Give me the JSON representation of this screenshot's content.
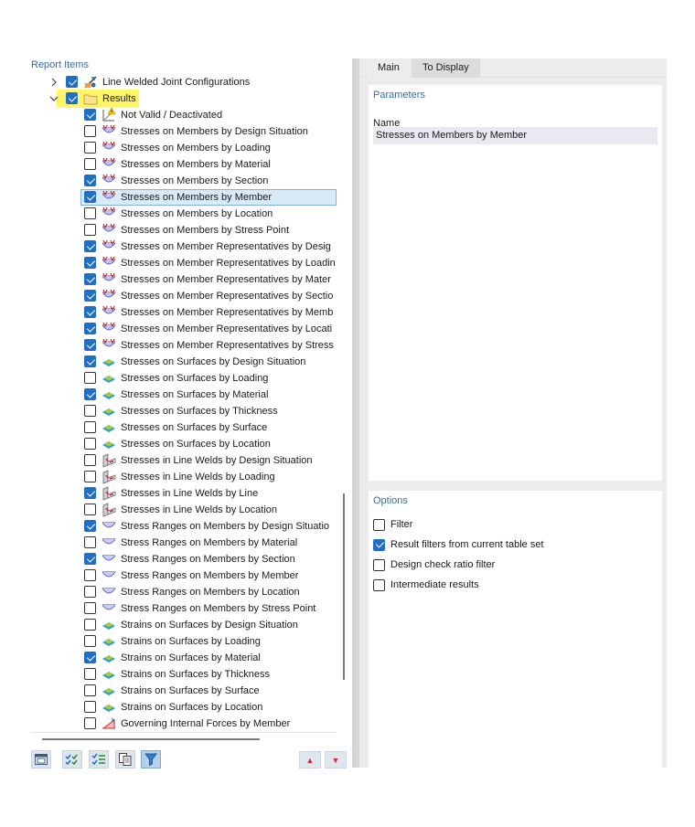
{
  "left_panel": {
    "title": "Report Items"
  },
  "tree": [
    {
      "label": "Line Welded Joint Configurations",
      "checked": true,
      "level": 0,
      "expander": "collapsed",
      "icon": "weld-config-icon"
    },
    {
      "label": "Results",
      "checked": true,
      "level": 0,
      "expander": "expanded",
      "icon": "folder-icon",
      "highlighted": true
    },
    {
      "label": "Not Valid / Deactivated",
      "checked": true,
      "level": 1,
      "icon": "warning-member-icon"
    },
    {
      "label": "Stresses on Members by Design Situation",
      "checked": false,
      "level": 1,
      "icon": "member-stress-icon"
    },
    {
      "label": "Stresses on Members by Loading",
      "checked": false,
      "level": 1,
      "icon": "member-stress-icon"
    },
    {
      "label": "Stresses on Members by Material",
      "checked": false,
      "level": 1,
      "icon": "member-stress-icon"
    },
    {
      "label": "Stresses on Members by Section",
      "checked": true,
      "level": 1,
      "icon": "member-stress-icon"
    },
    {
      "label": "Stresses on Members by Member",
      "checked": true,
      "level": 1,
      "icon": "member-stress-icon",
      "selected": true
    },
    {
      "label": "Stresses on Members by Location",
      "checked": false,
      "level": 1,
      "icon": "member-stress-icon"
    },
    {
      "label": "Stresses on Members by Stress Point",
      "checked": false,
      "level": 1,
      "icon": "member-stress-icon"
    },
    {
      "label": "Stresses on Member Representatives by Desig",
      "checked": true,
      "level": 1,
      "icon": "member-stress-icon"
    },
    {
      "label": "Stresses on Member Representatives by Loadin",
      "checked": true,
      "level": 1,
      "icon": "member-stress-icon"
    },
    {
      "label": "Stresses on Member Representatives by Mater",
      "checked": true,
      "level": 1,
      "icon": "member-stress-icon"
    },
    {
      "label": "Stresses on Member Representatives by Sectio",
      "checked": true,
      "level": 1,
      "icon": "member-stress-icon"
    },
    {
      "label": "Stresses on Member Representatives by Memb",
      "checked": true,
      "level": 1,
      "icon": "member-stress-icon"
    },
    {
      "label": "Stresses on Member Representatives by Locati",
      "checked": true,
      "level": 1,
      "icon": "member-stress-icon"
    },
    {
      "label": "Stresses on Member Representatives by Stress",
      "checked": true,
      "level": 1,
      "icon": "member-stress-icon"
    },
    {
      "label": "Stresses on Surfaces by Design Situation",
      "checked": true,
      "level": 1,
      "icon": "surface-stress-icon"
    },
    {
      "label": "Stresses on Surfaces by Loading",
      "checked": false,
      "level": 1,
      "icon": "surface-stress-icon"
    },
    {
      "label": "Stresses on Surfaces by Material",
      "checked": true,
      "level": 1,
      "icon": "surface-stress-icon"
    },
    {
      "label": "Stresses on Surfaces by Thickness",
      "checked": false,
      "level": 1,
      "icon": "surface-stress-icon"
    },
    {
      "label": "Stresses on Surfaces by Surface",
      "checked": false,
      "level": 1,
      "icon": "surface-stress-icon"
    },
    {
      "label": "Stresses on Surfaces by Location",
      "checked": false,
      "level": 1,
      "icon": "surface-stress-icon"
    },
    {
      "label": "Stresses in Line Welds by Design Situation",
      "checked": false,
      "level": 1,
      "icon": "weld-stress-icon"
    },
    {
      "label": "Stresses in Line Welds by Loading",
      "checked": false,
      "level": 1,
      "icon": "weld-stress-icon"
    },
    {
      "label": "Stresses in Line Welds by Line",
      "checked": true,
      "level": 1,
      "icon": "weld-stress-icon"
    },
    {
      "label": "Stresses in Line Welds by Location",
      "checked": false,
      "level": 1,
      "icon": "weld-stress-icon"
    },
    {
      "label": "Stress Ranges on Members by Design Situatio",
      "checked": true,
      "level": 1,
      "icon": "stress-range-icon"
    },
    {
      "label": "Stress Ranges on Members by Material",
      "checked": false,
      "level": 1,
      "icon": "stress-range-icon"
    },
    {
      "label": "Stress Ranges on Members by Section",
      "checked": true,
      "level": 1,
      "icon": "stress-range-icon"
    },
    {
      "label": "Stress Ranges on Members by Member",
      "checked": false,
      "level": 1,
      "icon": "stress-range-icon"
    },
    {
      "label": "Stress Ranges on Members by Location",
      "checked": false,
      "level": 1,
      "icon": "stress-range-icon"
    },
    {
      "label": "Stress Ranges on Members by Stress Point",
      "checked": false,
      "level": 1,
      "icon": "stress-range-icon"
    },
    {
      "label": "Strains on Surfaces by Design Situation",
      "checked": false,
      "level": 1,
      "icon": "surface-stress-icon"
    },
    {
      "label": "Strains on Surfaces by Loading",
      "checked": false,
      "level": 1,
      "icon": "surface-stress-icon"
    },
    {
      "label": "Strains on Surfaces by Material",
      "checked": true,
      "level": 1,
      "icon": "surface-stress-icon"
    },
    {
      "label": "Strains on Surfaces by Thickness",
      "checked": false,
      "level": 1,
      "icon": "surface-stress-icon"
    },
    {
      "label": "Strains on Surfaces by Surface",
      "checked": false,
      "level": 1,
      "icon": "surface-stress-icon"
    },
    {
      "label": "Strains on Surfaces by Location",
      "checked": false,
      "level": 1,
      "icon": "surface-stress-icon"
    },
    {
      "label": "Governing Internal Forces by Member",
      "checked": false,
      "level": 1,
      "icon": "internal-forces-icon"
    }
  ],
  "toolbar": {
    "buttons": [
      "window-icon",
      "check-all-icon",
      "toggle-check-icon",
      "report-copy-icon",
      "filter-icon"
    ],
    "move_up_glyph": "▲",
    "move_down_glyph": "▼"
  },
  "tabs": {
    "main": "Main",
    "to_display": "To Display"
  },
  "parameters": {
    "title": "Parameters",
    "name_label": "Name",
    "name_value": "Stresses on Members by Member"
  },
  "options": {
    "title": "Options",
    "items": [
      {
        "label": "Filter",
        "checked": false
      },
      {
        "label": "Result filters from current table set",
        "checked": true
      },
      {
        "label": "Design check ratio filter",
        "checked": false
      },
      {
        "label": "Intermediate results",
        "checked": false
      }
    ]
  },
  "colors": {
    "accent": "#2f6fa8",
    "checkbox": "#1f6fc4",
    "highlight": "#fff567",
    "selection": "#d9ebf9"
  }
}
